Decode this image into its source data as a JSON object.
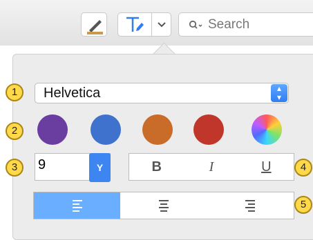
{
  "toolbar": {
    "search_placeholder": "Search"
  },
  "font": {
    "selected": "Helvetica"
  },
  "colors": [
    "#6a3ea1",
    "#3f72cc",
    "#c96c2a",
    "#c0362b"
  ],
  "size": {
    "value": "9"
  },
  "style_buttons": {
    "bold": "B",
    "italic": "I",
    "underline": "U"
  },
  "alignment": {
    "selected": "left"
  },
  "callouts": [
    "1",
    "2",
    "3",
    "4",
    "5"
  ]
}
